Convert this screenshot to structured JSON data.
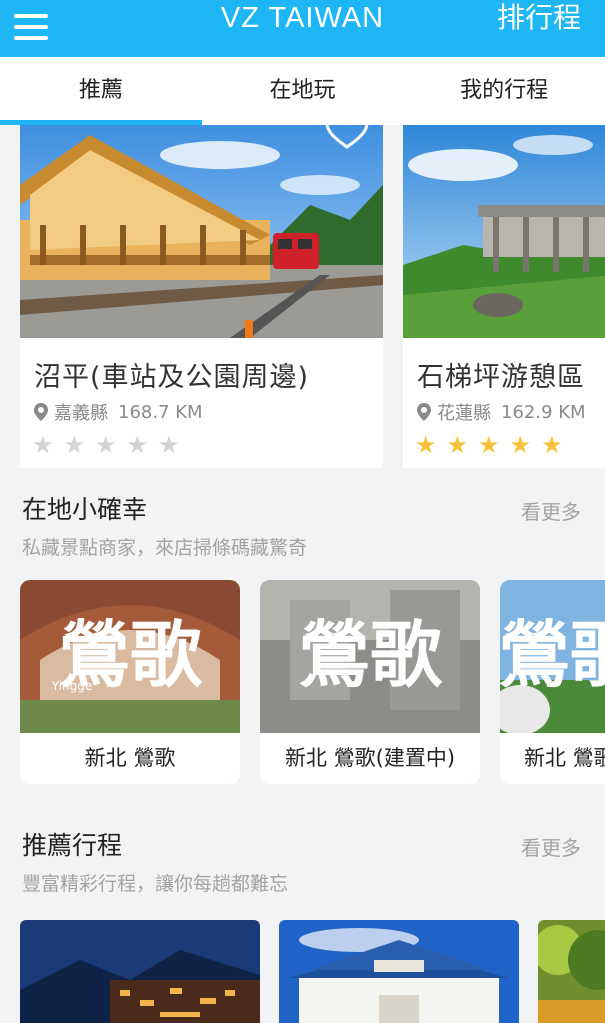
{
  "header": {
    "title": "VZ TAIWAN",
    "right_label": "排行程",
    "background": "#1fb6f5"
  },
  "tabs": [
    {
      "label": "推薦",
      "active": true
    },
    {
      "label": "在地玩",
      "active": false
    },
    {
      "label": "我的行程",
      "active": false
    }
  ],
  "featured": [
    {
      "title": "沼平(車站及公園周邊)",
      "county": "嘉義縣",
      "distance": "168.7 KM",
      "rating": 0
    },
    {
      "title": "石梯坪游憩區",
      "county": "花蓮縣",
      "distance": "162.9 KM",
      "rating": 5
    }
  ],
  "section_local": {
    "title": "在地小確幸",
    "subtitle": "私藏景點商家，來店掃條碼藏驚奇",
    "more": "看更多",
    "cards": [
      {
        "caption": "新北 鶯歌",
        "logo_text": "鶯歌",
        "logo_small": "Yingge"
      },
      {
        "caption": "新北 鶯歌(建置中)",
        "logo_text": "鶯歌"
      },
      {
        "caption": "新北 鶯歌",
        "logo_text": "鶯歌"
      }
    ]
  },
  "section_trips": {
    "title": "推薦行程",
    "subtitle": "豐富精彩行程，讓你每趟都難忘",
    "more": "看更多"
  },
  "colors": {
    "star_active": "#f9c13a",
    "star_inactive": "#d3d3d3"
  }
}
